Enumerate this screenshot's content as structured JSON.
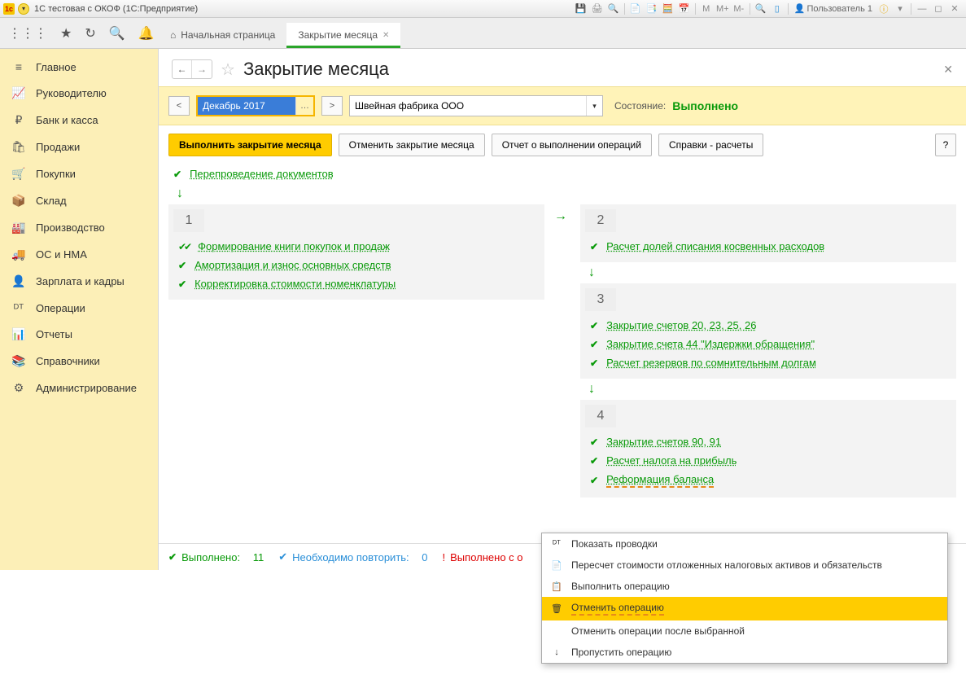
{
  "title": "1С тестовая с ОКОФ  (1С:Предприятие)",
  "user": "Пользователь 1",
  "tabs": {
    "home": "Начальная страница",
    "active": "Закрытие месяца"
  },
  "sidebar": [
    {
      "icon": "≡",
      "label": "Главное"
    },
    {
      "icon": "📈",
      "label": "Руководителю"
    },
    {
      "icon": "₽",
      "label": "Банк и касса"
    },
    {
      "icon": "🛍",
      "label": "Продажи"
    },
    {
      "icon": "🛒",
      "label": "Покупки"
    },
    {
      "icon": "📦",
      "label": "Склад"
    },
    {
      "icon": "🏭",
      "label": "Производство"
    },
    {
      "icon": "🚚",
      "label": "ОС и НМА"
    },
    {
      "icon": "👤",
      "label": "Зарплата и кадры"
    },
    {
      "icon": "ᴰᵀ",
      "label": "Операции"
    },
    {
      "icon": "📊",
      "label": "Отчеты"
    },
    {
      "icon": "📚",
      "label": "Справочники"
    },
    {
      "icon": "⚙",
      "label": "Администрирование"
    }
  ],
  "page": {
    "title": "Закрытие месяца",
    "period": "Декабрь 2017",
    "org": "Швейная фабрика ООО",
    "status_label": "Состояние:",
    "status_value": "Выполнено",
    "btn_run": "Выполнить закрытие месяца",
    "btn_cancel": "Отменить закрытие месяца",
    "btn_report": "Отчет о выполнении операций",
    "btn_ref": "Справки - расчеты",
    "btn_help": "?"
  },
  "ops": {
    "reproc": "Перепроведение документов",
    "b1": [
      "Формирование книги покупок и продаж",
      "Амортизация и износ основных средств",
      "Корректировка стоимости номенклатуры"
    ],
    "b2": [
      "Расчет долей списания косвенных расходов"
    ],
    "b3": [
      "Закрытие счетов 20, 23, 25, 26",
      "Закрытие счета 44 \"Издержки обращения\"",
      "Расчет резервов по сомнительным долгам"
    ],
    "b4": [
      "Закрытие счетов 90, 91",
      "Расчет налога на прибыль",
      "Реформация баланса"
    ]
  },
  "statusbar": {
    "done_lbl": "Выполнено:",
    "done_n": "11",
    "repeat_lbl": "Необходимо повторить:",
    "repeat_n": "0",
    "err_lbl": "Выполнено с о"
  },
  "ctx": [
    {
      "icon": "ᴰᵀ",
      "label": "Показать проводки",
      "hl": false
    },
    {
      "icon": "📄",
      "label": "Пересчет стоимости отложенных налоговых активов и обязательств",
      "hl": false
    },
    {
      "icon": "📋",
      "label": "Выполнить операцию",
      "hl": false
    },
    {
      "icon": "🗑",
      "label": "Отменить операцию",
      "hl": true
    },
    {
      "icon": "",
      "label": "Отменить операции после выбранной",
      "hl": false
    },
    {
      "icon": "↓",
      "label": "Пропустить операцию",
      "hl": false
    }
  ]
}
